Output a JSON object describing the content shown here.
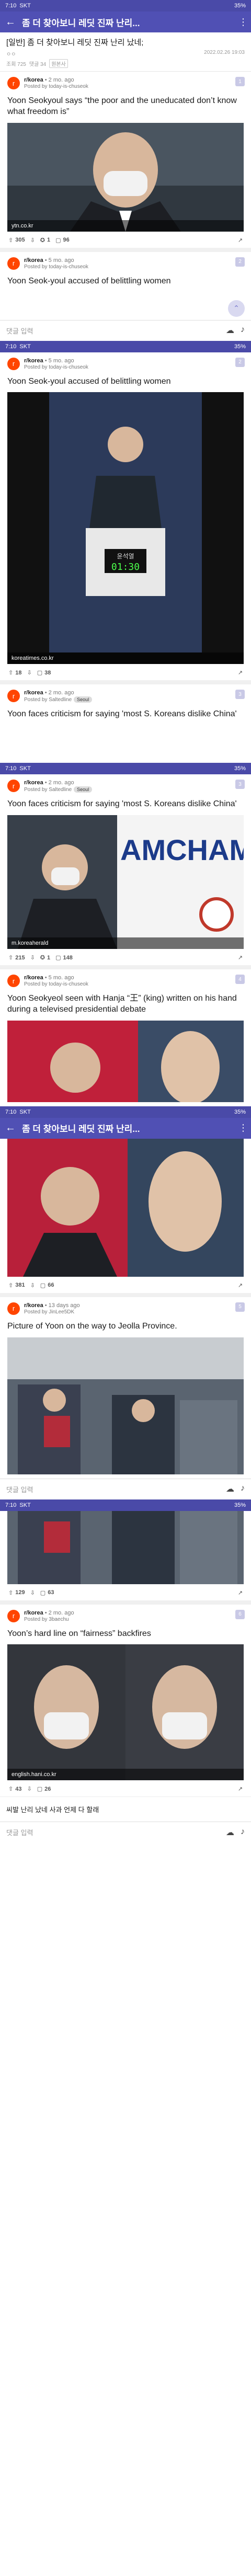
{
  "status": {
    "time": "7:10",
    "carrier": "SKT",
    "battery": "35%"
  },
  "status2": {
    "time": "7:10",
    "carrier": "SKT",
    "battery": "35%"
  },
  "title_bar": {
    "title": "좀 더 찾아보니 레딧 진짜 난리..."
  },
  "post": {
    "title": "[일반] 좀 더 찾아보니 레딧 진짜 난리 났네;",
    "author": "ㅇㅇ",
    "date": "2022.02.26 19:03",
    "views": "조회 725",
    "comments": "댓글 34",
    "tag": "원본사"
  },
  "cards": [
    {
      "rank": "1",
      "sub": "r/korea",
      "age": "• 2 mo. ago",
      "by": "Posted by today-is-chuseok",
      "flair": "",
      "headline": "Yoon Seokyoul says “the poor and the uneducated don’t know what freedom is”",
      "domain": "ytn.co.kr",
      "up": "305",
      "awards": "1",
      "comments": "96"
    },
    {
      "rank": "2",
      "sub": "r/korea",
      "age": "• 5 mo. ago",
      "by": "Posted by today-is-chuseok",
      "flair": "",
      "headline": "Yoon Seok-youl accused of belittling women",
      "domain": "koreatimes.co.kr",
      "up": "18",
      "awards": "",
      "comments": "38"
    },
    {
      "rank": "3",
      "sub": "r/korea",
      "age": "• 2 mo. ago",
      "by": "Posted by Saltedline",
      "flair": "Seoul",
      "headline": "Yoon faces criticism for saying 'most S. Koreans dislike China'",
      "domain": "m.koreaherald",
      "up": "215",
      "awards": "1",
      "comments": "148"
    },
    {
      "rank": "4",
      "sub": "r/korea",
      "age": "• 5 mo. ago",
      "by": "Posted by today-is-chuseok",
      "flair": "",
      "headline": "Yoon Seokyeol seen with Hanja “王” (king) written on his hand during a televised presidential debate",
      "domain": "",
      "up": "381",
      "awards": "",
      "comments": "66"
    },
    {
      "rank": "5",
      "sub": "r/korea",
      "age": "• 13 days ago",
      "by": "Posted by JinLee5DK",
      "flair": "",
      "headline": "Picture of Yoon on the way to Jeolla Province.",
      "domain": "",
      "up": "129",
      "awards": "",
      "comments": "63"
    },
    {
      "rank": "6",
      "sub": "r/korea",
      "age": "• 2 mo. ago",
      "by": "Posted by 3baechu",
      "flair": "",
      "headline": "Yoon’s hard line on “fairness” backfires",
      "domain": "english.hani.co.kr",
      "up": "43",
      "awards": "",
      "comments": "26"
    }
  ],
  "comment_bar": {
    "placeholder": "댓글 입력"
  },
  "closing_text": "씨발 난리 났네 사과 언제 다 할래"
}
